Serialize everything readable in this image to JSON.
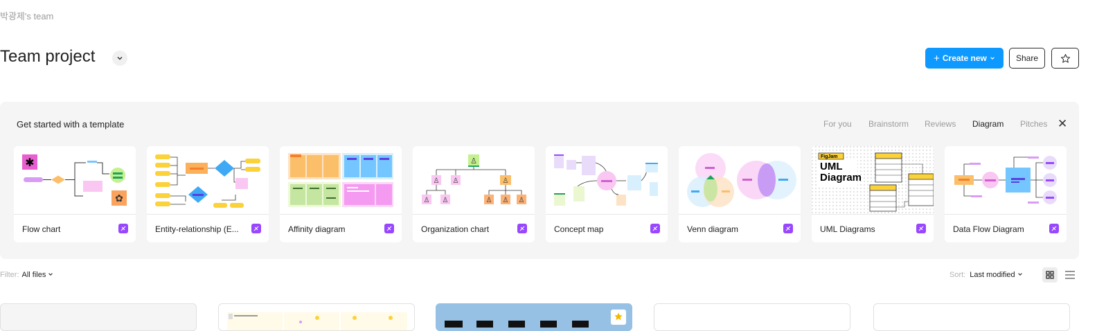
{
  "header": {
    "team_name": "박광제's team",
    "project_title": "Team project",
    "create_new_label": "Create new",
    "share_label": "Share"
  },
  "templates": {
    "title": "Get started with a template",
    "tabs": [
      {
        "label": "For you",
        "active": false
      },
      {
        "label": "Brainstorm",
        "active": false
      },
      {
        "label": "Reviews",
        "active": false
      },
      {
        "label": "Diagram",
        "active": true
      },
      {
        "label": "Pitches",
        "active": false
      }
    ],
    "cards": [
      {
        "label": "Flow chart",
        "icon": "flow-chart-thumbnail"
      },
      {
        "label": "Entity-relationship (E...",
        "icon": "erd-thumbnail"
      },
      {
        "label": "Affinity diagram",
        "icon": "affinity-thumbnail"
      },
      {
        "label": "Organization chart",
        "icon": "org-chart-thumbnail"
      },
      {
        "label": "Concept map",
        "icon": "concept-map-thumbnail"
      },
      {
        "label": "Venn diagram",
        "icon": "venn-thumbnail"
      },
      {
        "label": "UML Diagrams",
        "icon": "uml-thumbnail",
        "thumb_text": [
          "FigJam",
          "UML",
          "Diagram"
        ]
      },
      {
        "label": "Data Flow Diagram",
        "icon": "data-flow-thumbnail"
      }
    ]
  },
  "toolbar": {
    "filter_label": "Filter:",
    "filter_value": "All files",
    "sort_label": "Sort:",
    "sort_value": "Last modified"
  },
  "colors": {
    "accent": "#0d99ff",
    "figjam_badge": "#9747ff",
    "panel_bg": "#f5f5f5"
  }
}
